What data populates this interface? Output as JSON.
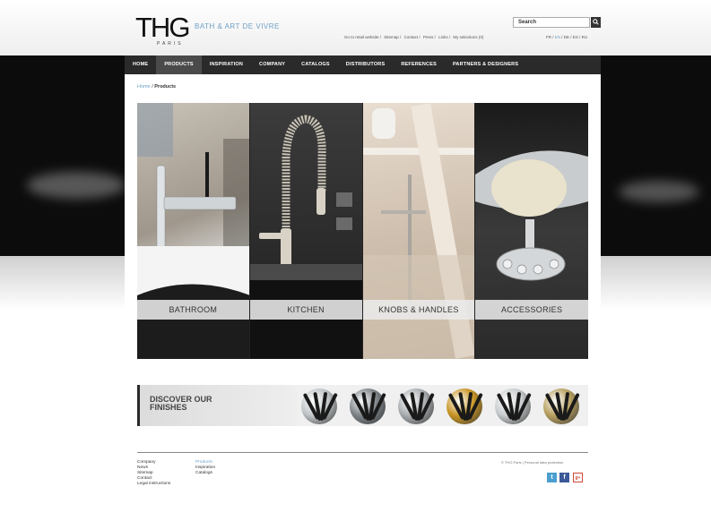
{
  "header": {
    "logo_main": "THG",
    "logo_sub": "PARIS",
    "tagline": "BATH & ART DE VIVRE",
    "search_label": "Search",
    "search_button": "Q",
    "toplinks": [
      "Go to retail website /",
      "Sitemap /",
      "Contact /",
      "Press /",
      "Links /",
      "My selections (0)"
    ],
    "languages": [
      "FR /",
      "EN",
      "/ DE /",
      "ES /",
      "RU"
    ]
  },
  "nav": {
    "items": [
      "HOME",
      "PRODUCTS",
      "INSPIRATION",
      "COMPANY",
      "CATALOGS",
      "DISTRIBUTORS",
      "REFERENCES",
      "PARTNERS & DESIGNERS"
    ]
  },
  "breadcrumb": {
    "home": "Home",
    "separator": "/",
    "current": "Products"
  },
  "categories": [
    {
      "label": "BATHROOM"
    },
    {
      "label": "KITCHEN"
    },
    {
      "label": "KNOBS & HANDLES"
    },
    {
      "label": "ACCESSORIES"
    }
  ],
  "finishes": {
    "title": "DISCOVER OUR FINISHES",
    "swatches": [
      {
        "name": "chrome-icon",
        "color": "#bfc4c6"
      },
      {
        "name": "dark-chrome-icon",
        "color": "#7d8388"
      },
      {
        "name": "silver-icon",
        "color": "#a9adb0"
      },
      {
        "name": "gold-icon",
        "color": "#c89525"
      },
      {
        "name": "nickel-icon",
        "color": "#c8ccce"
      },
      {
        "name": "gold-chrome-icon",
        "color": "#b8a060"
      }
    ]
  },
  "footer": {
    "col1": [
      "Company",
      "News",
      "Sitemap",
      "Contact",
      "Legal instructions"
    ],
    "col2": [
      "Products",
      "Inspiration",
      "Catalogs"
    ],
    "copyright": "© THG Paris | Personal data protection",
    "social": [
      "t",
      "f",
      "g+"
    ]
  },
  "colors": {
    "accent_blue": "#6fa0c6",
    "nav_bg": "#2a2a2a",
    "hero_bg": "#0c0c0c"
  }
}
